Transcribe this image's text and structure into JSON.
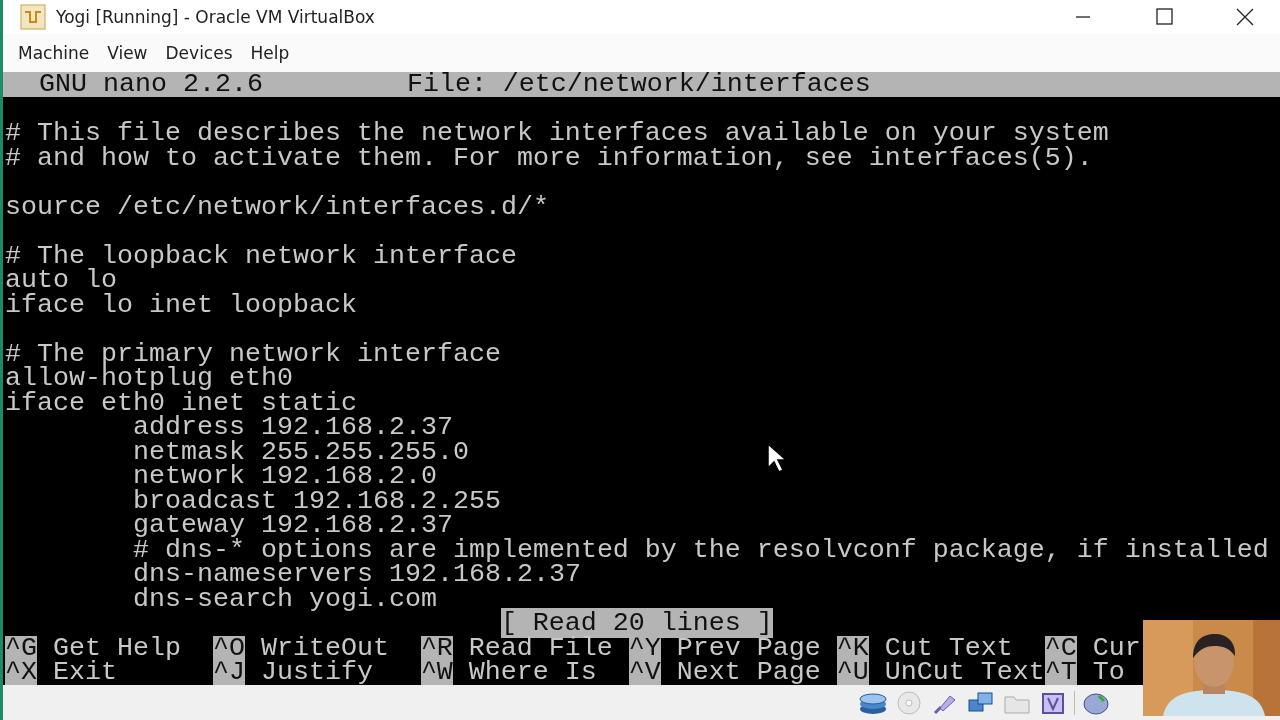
{
  "window": {
    "title": "Yogi [Running] - Oracle VM VirtualBox"
  },
  "menu": [
    "Machine",
    "View",
    "Devices",
    "Help"
  ],
  "nano": {
    "version": "GNU nano 2.2.6",
    "file": "File: /etc/network/interfaces",
    "blocks": [
      [
        "# This file describes the network interfaces available on your system",
        "# and how to activate them. For more information, see interfaces(5)."
      ],
      [
        "source /etc/network/interfaces.d/*"
      ],
      [
        "# The loopback network interface",
        "auto lo",
        "iface lo inet loopback"
      ],
      [
        "# The primary network interface",
        "allow-hotplug eth0",
        "iface eth0 inet static",
        "\taddress 192.168.2.37",
        "\tnetmask 255.255.255.0",
        "\tnetwork 192.168.2.0",
        "\tbroadcast 192.168.2.255",
        "\tgateway 192.168.2.37",
        "\t# dns-* options are implemented by the resolvconf package, if installed",
        "\tdns-nameservers 192.168.2.37",
        "\tdns-search yogi.com"
      ]
    ],
    "status": "[ Read 20 lines ]",
    "shortcuts": [
      [
        {
          "key": "^G",
          "label": "Get Help"
        },
        {
          "key": "^O",
          "label": "WriteOut"
        },
        {
          "key": "^R",
          "label": "Read File"
        },
        {
          "key": "^Y",
          "label": "Prev Page"
        },
        {
          "key": "^K",
          "label": "Cut Text"
        },
        {
          "key": "^C",
          "label": "Cur"
        }
      ],
      [
        {
          "key": "^X",
          "label": "Exit"
        },
        {
          "key": "^J",
          "label": "Justify"
        },
        {
          "key": "^W",
          "label": "Where Is"
        },
        {
          "key": "^V",
          "label": "Next Page"
        },
        {
          "key": "^U",
          "label": "UnCut Text"
        },
        {
          "key": "^T",
          "label": "To"
        }
      ]
    ]
  }
}
